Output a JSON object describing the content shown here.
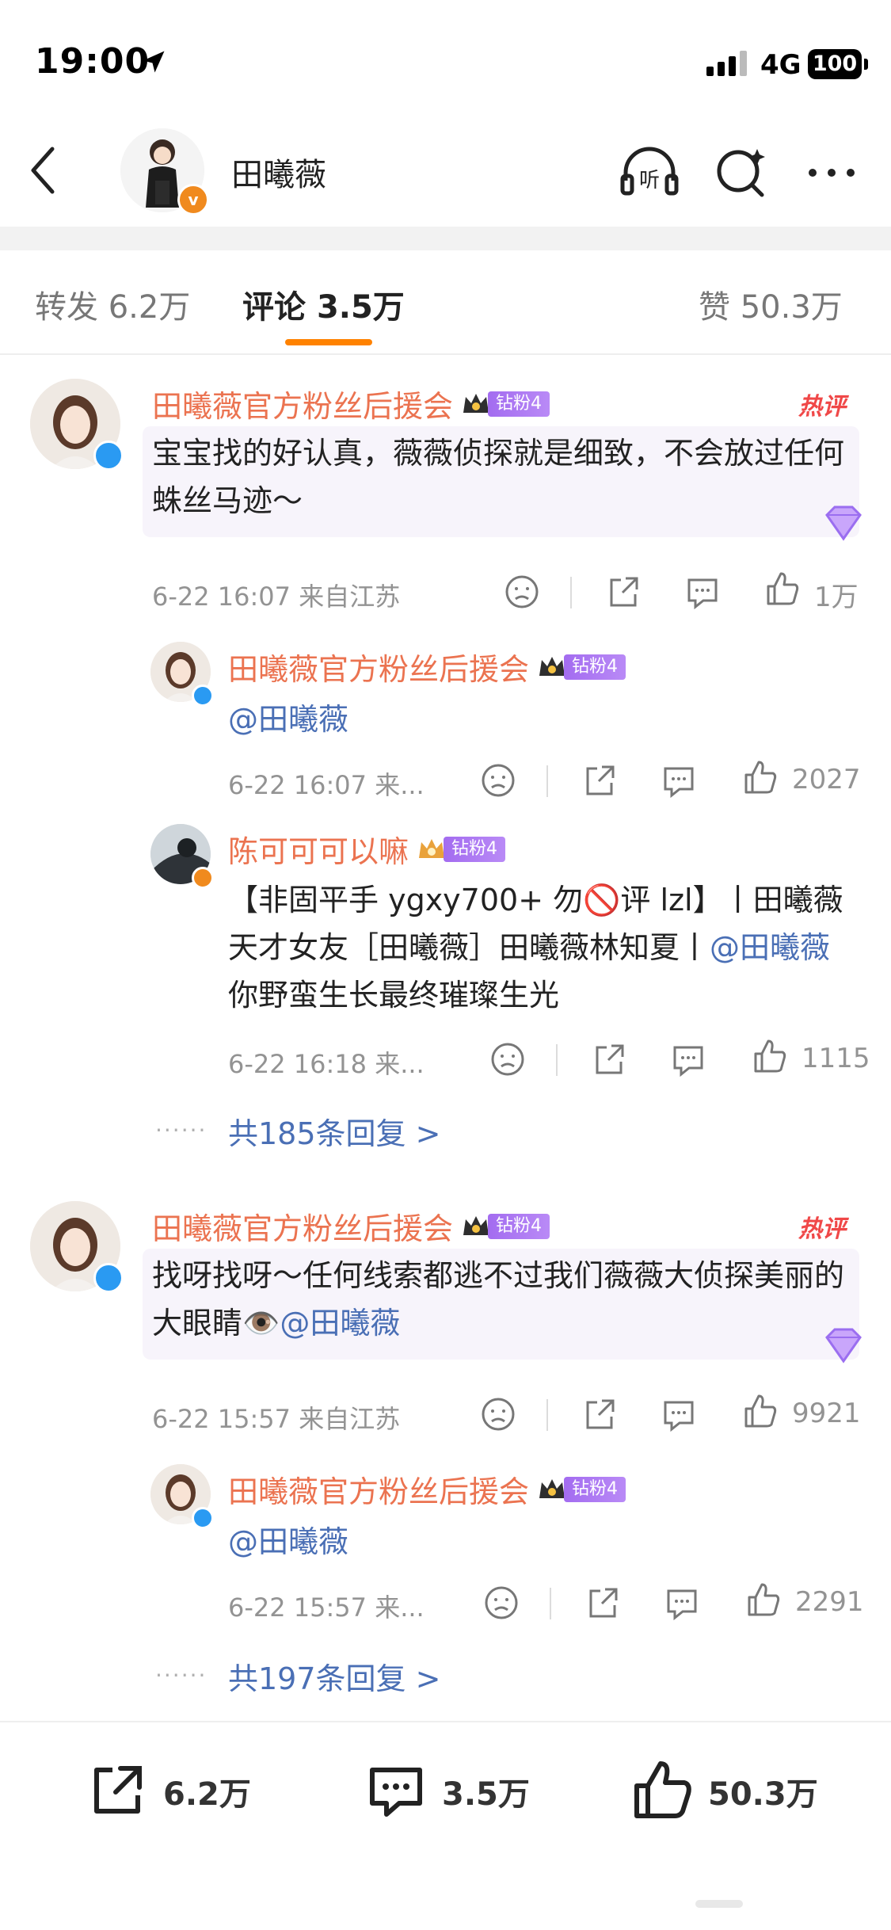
{
  "status": {
    "time": "19:00",
    "network": "4G",
    "battery": "100"
  },
  "header": {
    "username": "田曦薇",
    "verified_badge": "v",
    "icons": [
      "back-icon",
      "listen-icon",
      "search-icon",
      "more-icon"
    ],
    "listen_label": "听"
  },
  "tabs": {
    "repost": "转发 6.2万",
    "comment_label": "评论",
    "comment_count": "3.5万",
    "like": "赞 50.3万"
  },
  "comments": [
    {
      "user": "田曦薇官方粉丝后援会",
      "badge": "钻粉4",
      "tag": "热评",
      "text": "宝宝找的好认真，薇薇侦探就是细致，不会放过任何蛛丝马迹～",
      "meta": "6-22 16:07 来自江苏",
      "likes": "1万",
      "replies": [
        {
          "user": "田曦薇官方粉丝后援会",
          "badge": "钻粉4",
          "mention": "@田曦薇",
          "meta": "6-22 16:07 来...",
          "likes": "2027"
        },
        {
          "user": "陈可可可以嘛",
          "badge": "钻粉4",
          "text_part1": "【非固平手 ygxy700+ 勿🚫评 lzl】丨田曦薇天才女友［田曦薇］田曦薇林知夏丨",
          "mention": "@田曦薇",
          "text_part2": " 你野蛮生长最终璀璨生光",
          "meta": "6-22 16:18 来...",
          "likes": "1115"
        }
      ],
      "more_dots": "······",
      "more_replies": "共185条回复 >"
    },
    {
      "user": "田曦薇官方粉丝后援会",
      "badge": "钻粉4",
      "tag": "热评",
      "text": "找呀找呀～任何线索都逃不过我们薇薇大侦探美丽的大眼睛👁️",
      "mention": "@田曦薇",
      "meta": "6-22 15:57 来自江苏",
      "likes": "9921",
      "replies": [
        {
          "user": "田曦薇官方粉丝后援会",
          "badge": "钻粉4",
          "mention": "@田曦薇",
          "meta": "6-22 15:57 来...",
          "likes": "2291"
        }
      ],
      "more_dots": "······",
      "more_replies": "共197条回复 >"
    }
  ],
  "bottom_bar": {
    "repost": "6.2万",
    "comment": "3.5万",
    "like": "50.3万"
  },
  "colors": {
    "accent_orange": "#ff8200",
    "username_orange": "#eb7350",
    "link_blue": "#4a6fb5",
    "vip_purple": "#a36cf0",
    "hot_red": "#f04848"
  }
}
